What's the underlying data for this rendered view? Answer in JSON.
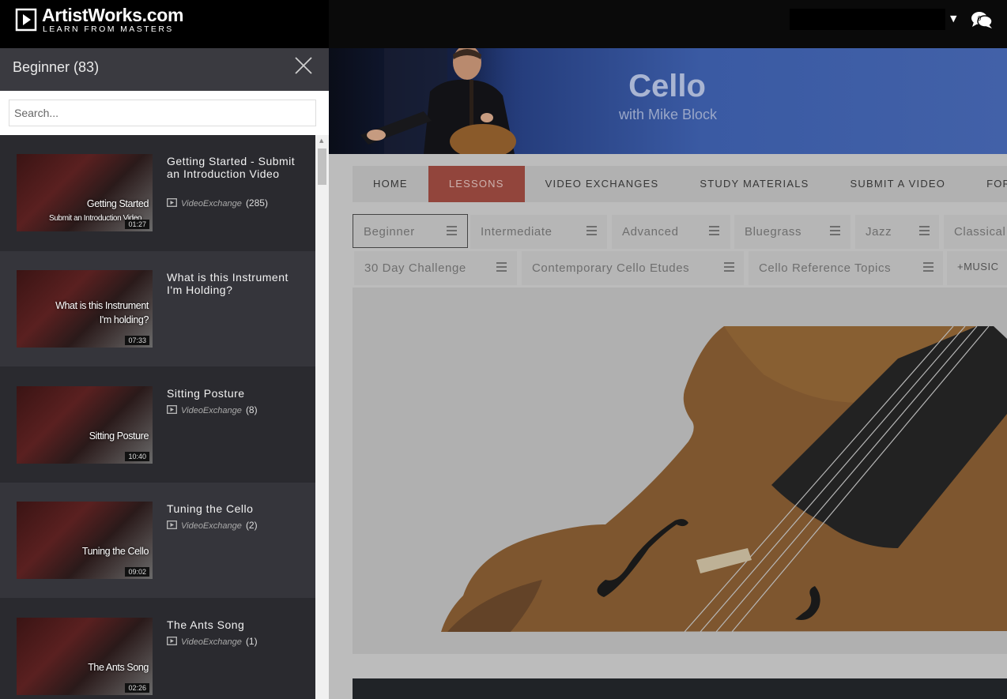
{
  "header": {
    "logo_title": "ArtistWorks.com",
    "logo_tagline": "LEARN FROM MASTERS",
    "notifications_count": "0"
  },
  "hero": {
    "title": "Cello",
    "subtitle": "with Mike Block"
  },
  "main_nav": [
    {
      "label": "HOME",
      "active": false
    },
    {
      "label": "LESSONS",
      "active": true
    },
    {
      "label": "VIDEO EXCHANGES",
      "active": false
    },
    {
      "label": "STUDY MATERIALS",
      "active": false
    },
    {
      "label": "SUBMIT A VIDEO",
      "active": false
    },
    {
      "label": "FORUM",
      "active": false
    }
  ],
  "categories_row1": [
    "Beginner",
    "Intermediate",
    "Advanced",
    "Bluegrass",
    "Jazz",
    "Classical"
  ],
  "categories_row2": [
    "30 Day Challenge",
    "Contemporary Cello Etudes",
    "Cello Reference Topics"
  ],
  "more_button": "+MUSIC",
  "sidebar": {
    "title": "Beginner (83)",
    "search_placeholder": "Search...",
    "items": [
      {
        "title": "Getting Started - Submit an Introduction Video",
        "thumb_text": "Getting Started",
        "thumb_sub": "Submit an Introduction Video",
        "duration": "01:27",
        "meta_label": "VideoExchange",
        "meta_count": "(285)"
      },
      {
        "title": "What is this Instrument I'm Holding?",
        "thumb_text": "What is this Instrument I'm holding?",
        "duration": "07:33",
        "meta_label": "",
        "meta_count": ""
      },
      {
        "title": "Sitting Posture",
        "thumb_text": "Sitting Posture",
        "duration": "10:40",
        "meta_label": "VideoExchange",
        "meta_count": "(8)"
      },
      {
        "title": "Tuning the Cello",
        "thumb_text": "Tuning the Cello",
        "duration": "09:02",
        "meta_label": "VideoExchange",
        "meta_count": "(2)"
      },
      {
        "title": "The Ants Song",
        "thumb_text": "The Ants Song",
        "duration": "02:26",
        "meta_label": "VideoExchange",
        "meta_count": "(1)"
      }
    ]
  },
  "colors": {
    "active_tab": "#a3453a",
    "sidebar_bg": "#2a2a2f",
    "hero_blue": "#4261a8"
  }
}
